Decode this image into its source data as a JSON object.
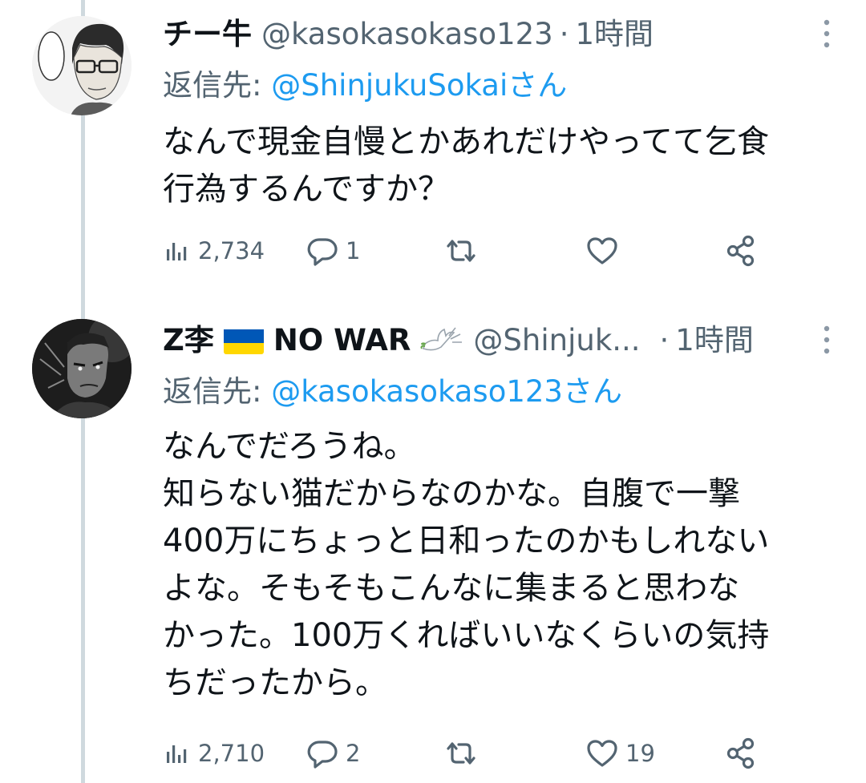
{
  "tweets": [
    {
      "display_name": "チー牛",
      "handle": "@kasokasokaso123",
      "separator": "·",
      "time": "1時間",
      "reply_label": "返信先: ",
      "reply_mention": "@ShinjukuSokaiさん",
      "text_lines": [
        "なんで現金自慢とかあれだけやってて乞食",
        "行為するんですか？"
      ],
      "stats": {
        "views": "2,734",
        "replies": "1",
        "retweets": "",
        "likes": ""
      }
    },
    {
      "display_name": "Z李",
      "name_suffix": "NO WAR",
      "handle": "@Shinjuk...",
      "separator": "·",
      "time": "1時間",
      "reply_label": "返信先: ",
      "reply_mention": "@kasokasokaso123さん",
      "text_lines": [
        "なんでだろうね。",
        "知らない猫だからなのかな。自腹で一撃",
        "400万にちょっと日和ったのかもしれない",
        "よな。そもそもこんなに集まると思わな",
        "かった。100万くればいいなくらいの気持",
        "ちだったから。"
      ],
      "stats": {
        "views": "2,710",
        "replies": "2",
        "retweets": "",
        "likes": "19"
      }
    }
  ],
  "colors": {
    "text_primary": "#0f1419",
    "text_secondary": "#536471",
    "link": "#1d9bf0",
    "thread_line": "#cfd9de",
    "flag_blue": "#0057b7",
    "flag_yellow": "#ffd700"
  },
  "icons": [
    "views-icon",
    "reply-icon",
    "retweet-icon",
    "like-icon",
    "share-icon",
    "more-icon",
    "ukraine-flag-icon",
    "dove-icon"
  ]
}
